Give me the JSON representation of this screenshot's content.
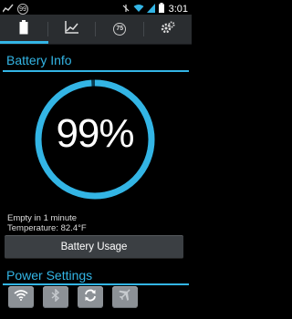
{
  "status_bar": {
    "time": "3:01",
    "notification_badge": "99"
  },
  "tabs": [
    {
      "name": "battery",
      "icon": "battery-icon",
      "active": true
    },
    {
      "name": "graph",
      "icon": "chart-icon",
      "active": false
    },
    {
      "name": "temperature",
      "icon": "temperature-badge",
      "badge": "75",
      "active": false
    },
    {
      "name": "settings",
      "icon": "settings-icon",
      "active": false
    }
  ],
  "battery_info": {
    "title": "Battery Info",
    "percent_label": "99%",
    "percent": 99,
    "empty_text": "Empty in 1 minute",
    "temperature_text": "Temperature: 82.4°F",
    "usage_button_label": "Battery Usage"
  },
  "power_settings": {
    "title": "Power Settings",
    "buttons": [
      "wifi-icon",
      "bluetooth-icon",
      "sync-icon",
      "airplane-icon"
    ]
  },
  "colors": {
    "accent": "#33b5e5",
    "tab_bg": "#2a2d30",
    "button_bg": "#8c9196"
  }
}
